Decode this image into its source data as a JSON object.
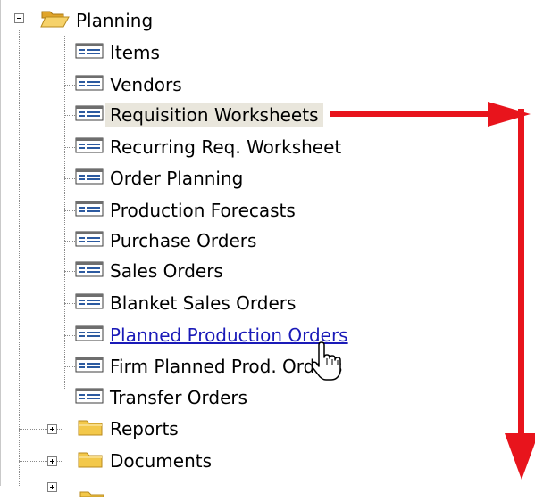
{
  "tree": {
    "root": {
      "label": "Planning",
      "expanded": true,
      "icon": "folder-open-icon"
    },
    "children": [
      {
        "label": "Items",
        "icon": "list-page-icon"
      },
      {
        "label": "Vendors",
        "icon": "list-page-icon"
      },
      {
        "label": "Requisition Worksheets",
        "icon": "list-page-icon",
        "state": "selected"
      },
      {
        "label": "Recurring Req. Worksheet",
        "icon": "list-page-icon"
      },
      {
        "label": "Order Planning",
        "icon": "list-page-icon"
      },
      {
        "label": "Production Forecasts",
        "icon": "list-page-icon"
      },
      {
        "label": "Purchase Orders",
        "icon": "list-page-icon"
      },
      {
        "label": "Sales Orders",
        "icon": "list-page-icon"
      },
      {
        "label": "Blanket Sales Orders",
        "icon": "list-page-icon"
      },
      {
        "label": "Planned Production Orders",
        "icon": "list-page-icon",
        "state": "hover-link"
      },
      {
        "label": "Firm Planned Prod. Orders",
        "icon": "list-page-icon"
      },
      {
        "label": "Transfer Orders",
        "icon": "list-page-icon"
      }
    ],
    "folders": [
      {
        "label": "Reports",
        "expanded": false,
        "icon": "folder-closed-icon"
      },
      {
        "label": "Documents",
        "expanded": false,
        "icon": "folder-closed-icon"
      }
    ]
  },
  "annotations": {
    "arrow_color": "#e8141c",
    "cursor": "hand-pointer-icon"
  },
  "colors": {
    "selected_bg": "#e9e6dc",
    "link": "#1a1ab8",
    "folder": "#f3c84a"
  }
}
